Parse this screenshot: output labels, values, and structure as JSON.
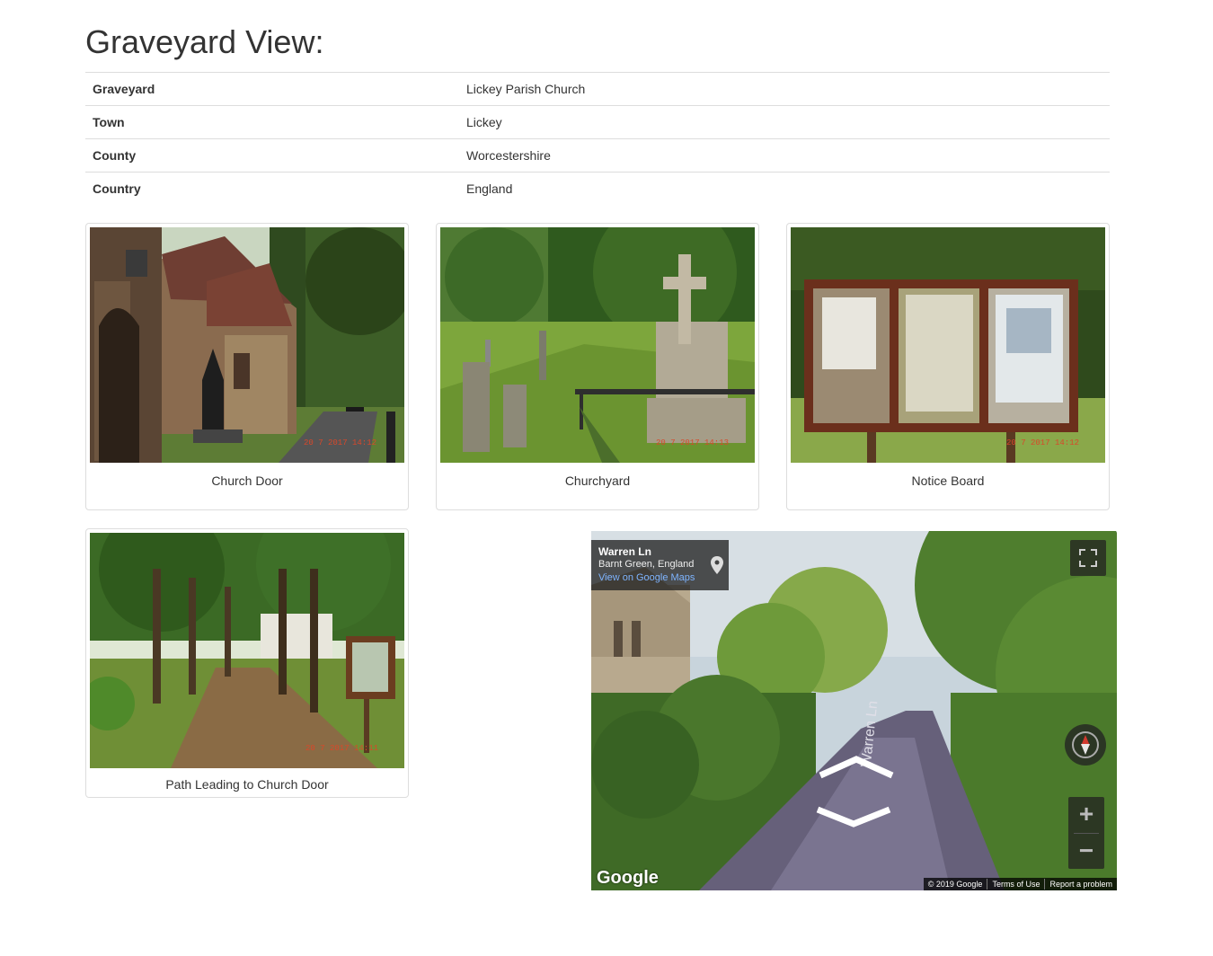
{
  "page": {
    "title": "Graveyard View:"
  },
  "details": [
    {
      "label": "Graveyard",
      "value": "Lickey Parish Church"
    },
    {
      "label": "Town",
      "value": "Lickey"
    },
    {
      "label": "County",
      "value": "Worcestershire"
    },
    {
      "label": "Country",
      "value": "England"
    }
  ],
  "photos": [
    {
      "caption": "Church Door"
    },
    {
      "caption": "Churchyard"
    },
    {
      "caption": "Notice Board"
    },
    {
      "caption": "Path Leading to Church Door"
    }
  ],
  "street_view": {
    "street": "Warren Ln",
    "area": "Barnt Green, England",
    "link": "View on Google Maps",
    "road_label": "Warren Ln",
    "logo": "Google",
    "copyright": "© 2019 Google",
    "terms": "Terms of Use",
    "report": "Report a problem",
    "zoom_in": "+",
    "zoom_out": "−"
  }
}
